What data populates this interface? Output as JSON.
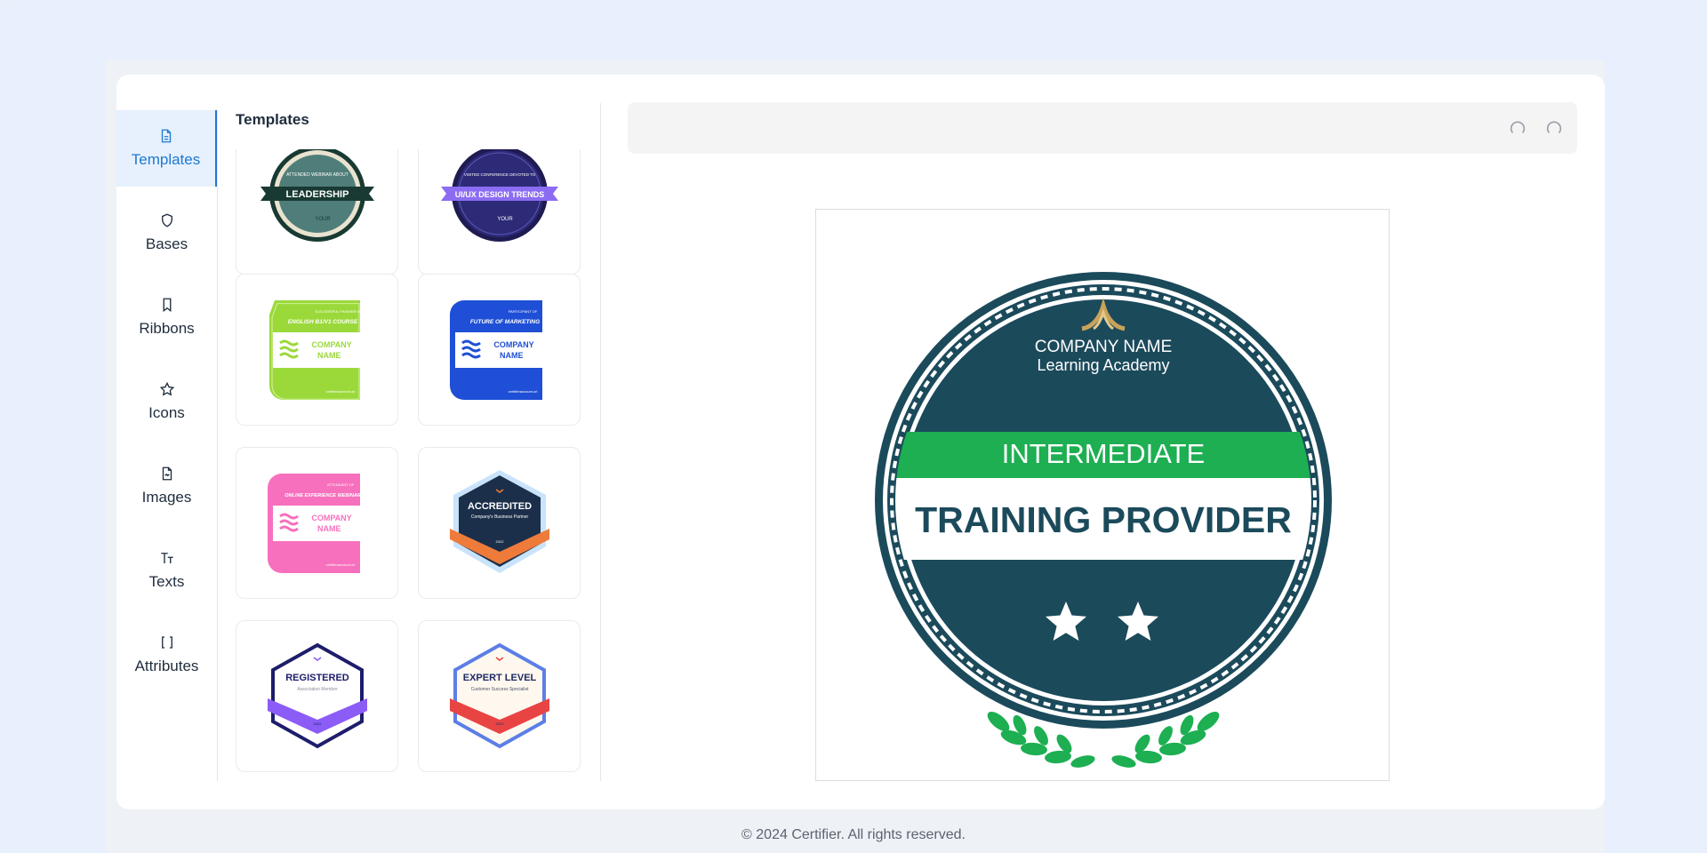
{
  "sidebar": {
    "items": [
      {
        "label": "Templates",
        "icon": "document-icon",
        "active": true
      },
      {
        "label": "Bases",
        "icon": "shield-icon"
      },
      {
        "label": "Ribbons",
        "icon": "bookmark-icon"
      },
      {
        "label": "Icons",
        "icon": "star-icon"
      },
      {
        "label": "Images",
        "icon": "image-file-icon"
      },
      {
        "label": "Texts",
        "icon": "text-icon"
      },
      {
        "label": "Attributes",
        "icon": "brackets-icon"
      }
    ]
  },
  "panel": {
    "title": "Templates",
    "templates": [
      {
        "name": "leadership",
        "top_text": "ATTENDED WEBINAR ABOUT",
        "ribbon_text": "LEADERSHIP",
        "logo_text": "YOUR"
      },
      {
        "name": "ui-ux",
        "top_text": "VISITED CONFERENCE DEVOTED TO",
        "ribbon_text": "UI/UX DESIGN TRENDS",
        "logo_text": "YOUR"
      },
      {
        "name": "english-course",
        "top_text": "SUCCESSFUL FINISHER OF",
        "title_text": "ENGLISH B1/V1 COURSE",
        "company_text_1": "COMPANY",
        "company_text_2": "NAME",
        "footer_text": "certifieraccount.url"
      },
      {
        "name": "future-marketing",
        "top_text": "PARTICIPANT OF",
        "title_text": "FUTURE OF MARKETING",
        "company_text_1": "COMPANY",
        "company_text_2": "NAME",
        "footer_text": "certifieraccount.url"
      },
      {
        "name": "ux-webinar",
        "top_text": "ATTENDANT OF",
        "title_text": "ONLINE EXPERIENCE WEBINAR",
        "company_text_1": "COMPANY",
        "company_text_2": "NAME",
        "footer_text": "certifieraccount.url"
      },
      {
        "name": "accredited",
        "title_text": "ACCREDITED",
        "sub_text": "Company's Business Partner",
        "year_text": "2022"
      },
      {
        "name": "registered",
        "title_text": "REGISTERED",
        "sub_text": "Association Member",
        "year_text": "2022"
      },
      {
        "name": "expert-level",
        "title_text": "EXPERT LEVEL",
        "sub_text": "Customer Success Specialist",
        "year_text": "2022"
      }
    ]
  },
  "toolbar": {
    "undo_icon": "undo-icon",
    "redo_icon": "redo-icon"
  },
  "badge": {
    "company": "COMPANY NAME",
    "academy": "Learning Academy",
    "level": "INTERMEDIATE",
    "title": "TRAINING PROVIDER",
    "stars": 2,
    "colors": {
      "navy": "#1b4a5b",
      "green": "#1daf52",
      "gold": "#c9a35b"
    }
  },
  "footer": {
    "text": "© 2024 Certifier. All rights reserved."
  }
}
